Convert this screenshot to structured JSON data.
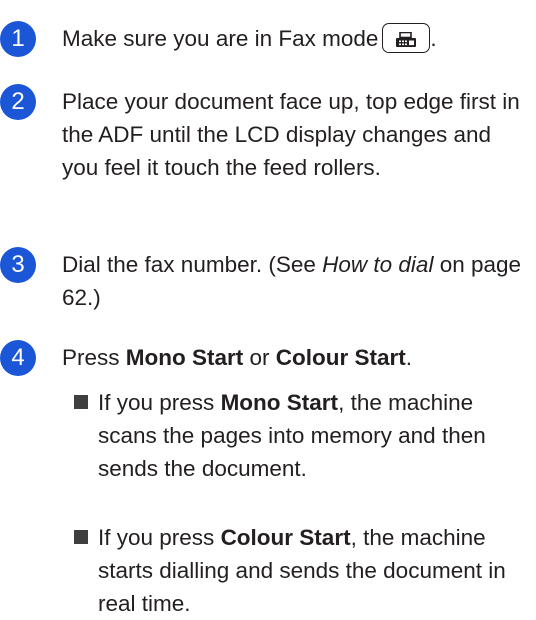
{
  "steps": [
    {
      "number": "1",
      "before_icon": "Make sure you are in Fax mode",
      "icon": "fax-mode-icon",
      "after_icon": "."
    },
    {
      "number": "2",
      "text": "Place your document face up, top edge first in the ADF until the LCD display changes and you feel it touch the feed rollers."
    },
    {
      "number": "3",
      "text_a": "Dial the fax number. (See ",
      "link_italic": "How to dial",
      "text_b": " on page 62.)"
    },
    {
      "number": "4",
      "press": "Press ",
      "mono_start": "Mono Start",
      "or": " or ",
      "colour_start": "Colour Start",
      "end": "."
    }
  ],
  "bullets": [
    {
      "prefix": "If you press ",
      "key": "Mono Start",
      "rest": ", the machine scans the pages into memory and then sends the document."
    },
    {
      "prefix": "If you press ",
      "key": "Colour Start",
      "rest": ", the machine starts dialling and sends the document in real time."
    }
  ],
  "colors": {
    "step_badge": "#1a56d6",
    "text": "#231f20",
    "bullet": "#3f3f3f"
  }
}
